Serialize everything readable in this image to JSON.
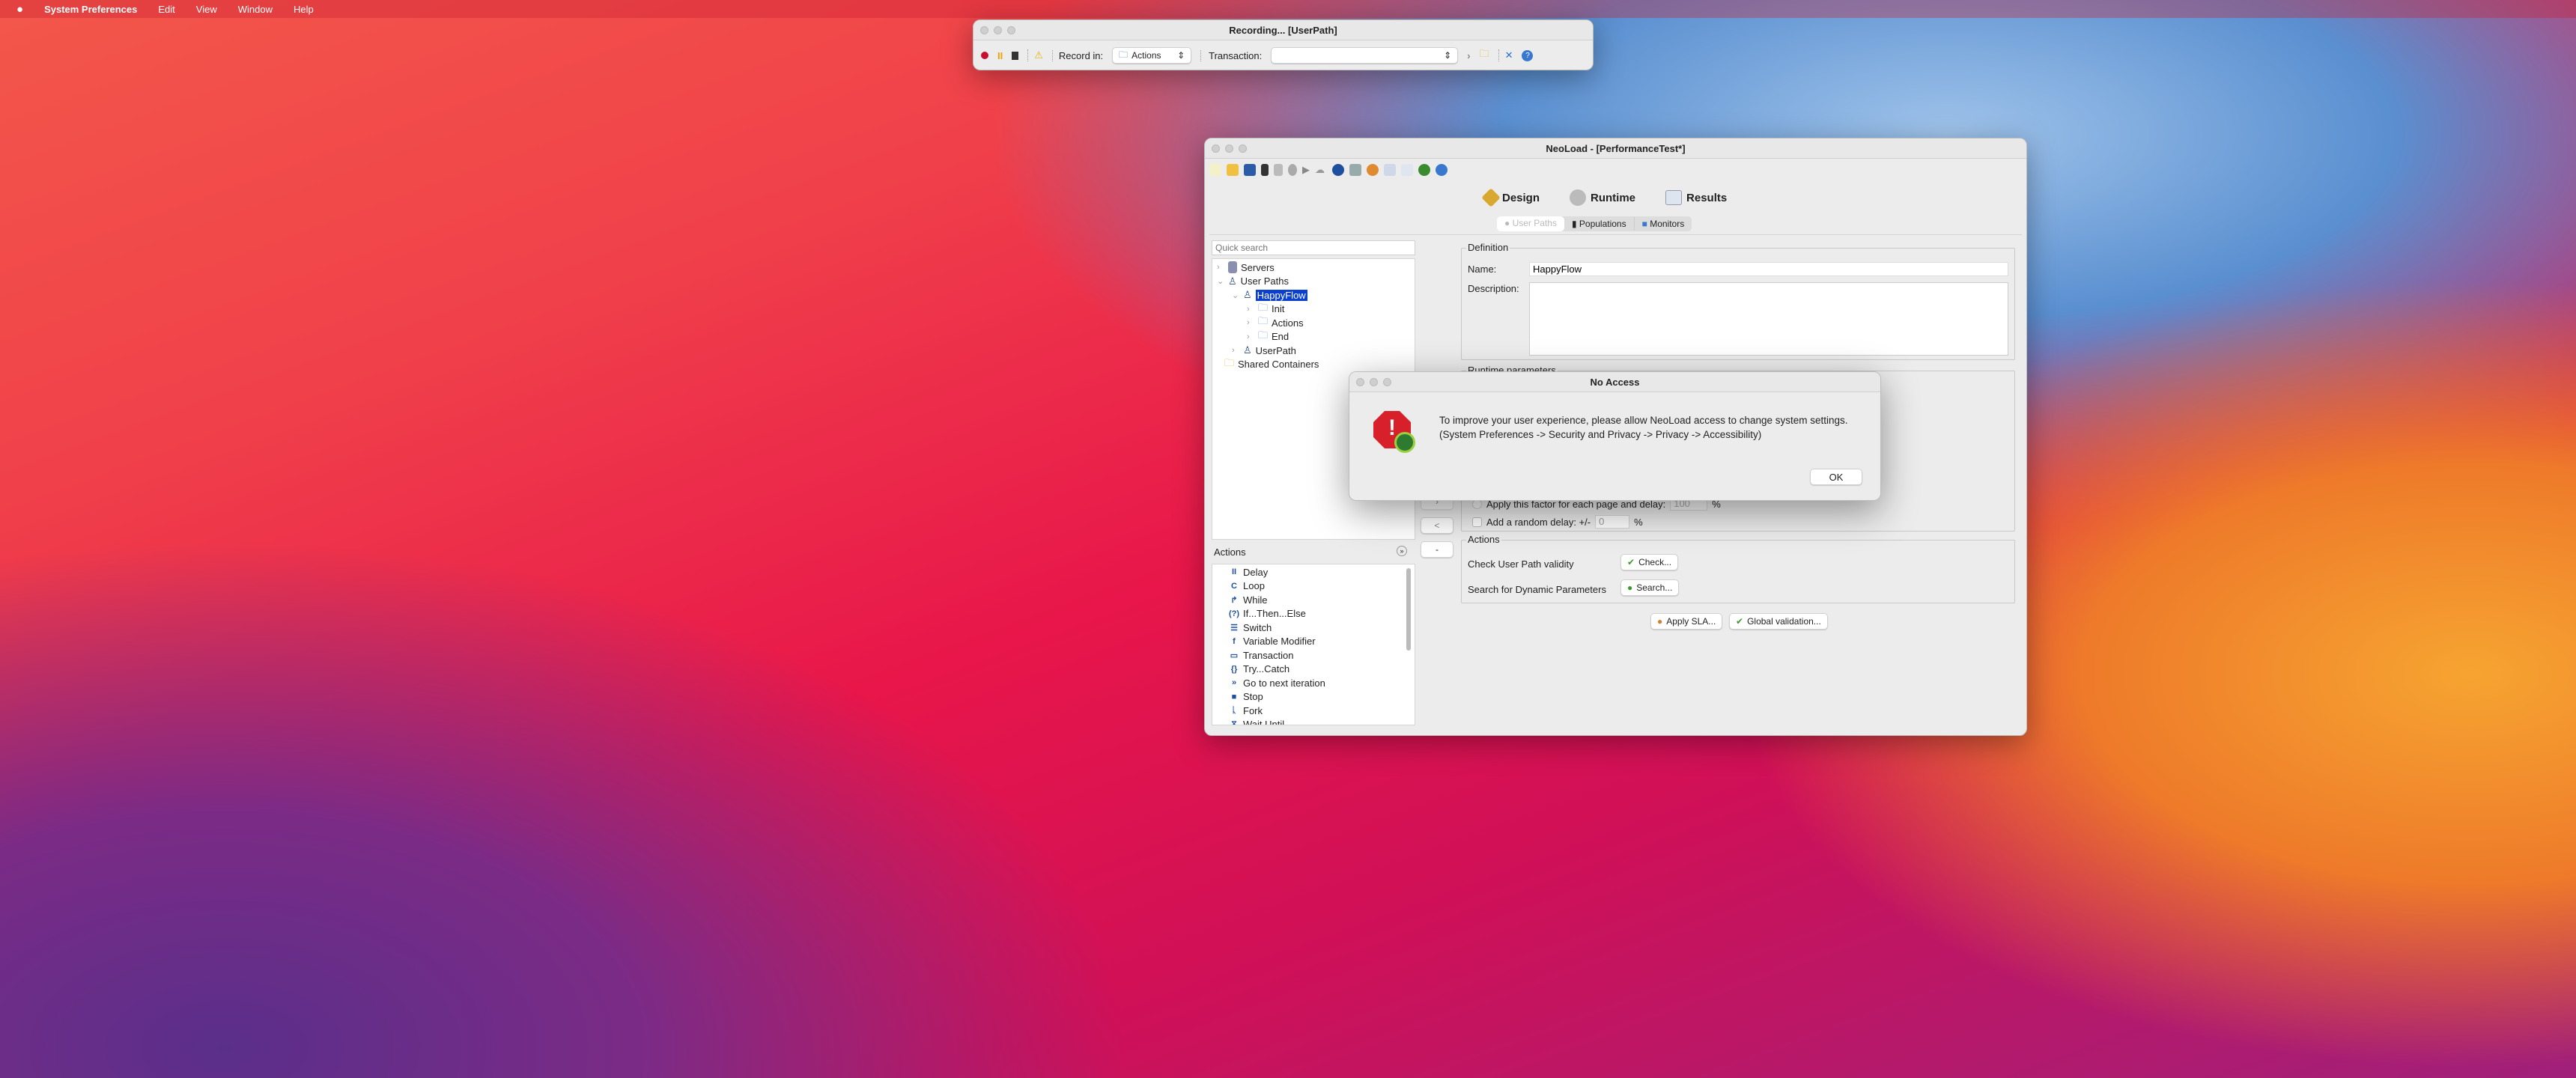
{
  "menubar": {
    "apple": "",
    "app": "System Preferences",
    "items": [
      "Edit",
      "View",
      "Window",
      "Help"
    ]
  },
  "recording": {
    "title": "Recording... [UserPath]",
    "record_in_label": "Record in:",
    "record_in_value": "Actions",
    "transaction_label": "Transaction:",
    "transaction_value": ""
  },
  "neoload": {
    "title": "NeoLoad - [PerformanceTest*]",
    "modes": [
      "Design",
      "Runtime",
      "Results"
    ],
    "subtabs": [
      "User Paths",
      "Populations",
      "Monitors"
    ],
    "search_placeholder": "Quick search",
    "tree": {
      "servers": "Servers",
      "user_paths": "User Paths",
      "happyflow": "HappyFlow",
      "init": "Init",
      "actions": "Actions",
      "end": "End",
      "userpath": "UserPath",
      "shared": "Shared Containers"
    },
    "actions_panel": {
      "title": "Actions",
      "items": [
        "Delay",
        "Loop",
        "While",
        "If...Then...Else",
        "Switch",
        "Variable Modifier",
        "Transaction",
        "Try...Catch",
        "Go to next iteration",
        "Stop",
        "Fork",
        "Wait Until"
      ],
      "icons": [
        "II",
        "C",
        "↱",
        "(?)",
        "☰",
        "f",
        "▭",
        "{}",
        "»",
        "■",
        "ᚳ",
        "⧖"
      ]
    },
    "nav_buttons": [
      "<",
      "-"
    ],
    "definition": {
      "title": "Definition",
      "name_label": "Name:",
      "name_value": "HappyFlow",
      "description_label": "Description:",
      "description_value": ""
    },
    "runtime": {
      "title": "Runtime parameters",
      "apply_factor_label": "Apply this factor for each page and delay:",
      "apply_factor_value": "100",
      "pct": "%",
      "random_delay_label": "Add a random delay: +/-",
      "random_delay_value": "0"
    },
    "actions_group": {
      "title": "Actions",
      "check_label": "Check User Path validity",
      "check_button": "Check...",
      "search_label": "Search for Dynamic Parameters",
      "search_button": "Search..."
    },
    "apply_sla": "Apply SLA...",
    "global_validation": "Global validation..."
  },
  "dialog": {
    "title": "No Access",
    "line1": "To improve your user experience, please allow NeoLoad access to change system settings.",
    "line2": "(System Preferences -> Security and Privacy -> Privacy -> Accessibility)",
    "ok": "OK"
  }
}
